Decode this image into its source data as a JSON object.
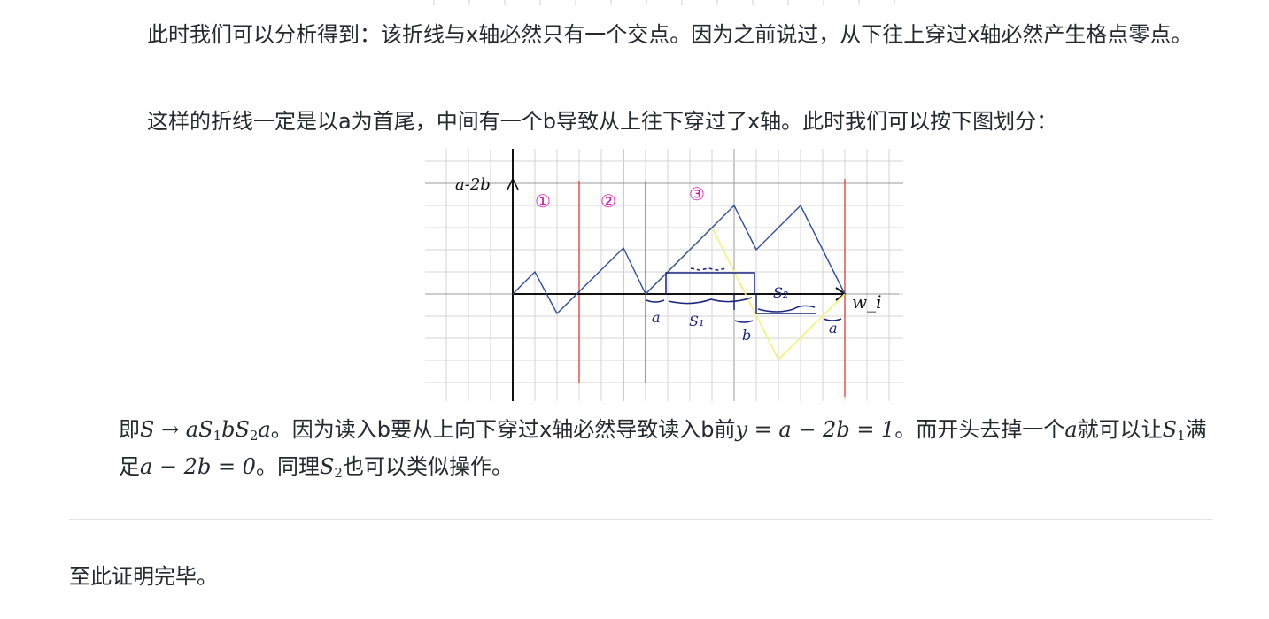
{
  "paragraph1": "此时我们可以分析得到：该折线与x轴必然只有一个交点。因为之前说过，从下往上穿过x轴必然产生格点零点。",
  "paragraph2": "这样的折线一定是以a为首尾，中间有一个b导致从上往下穿过了x轴。此时我们可以按下图划分：",
  "figure": {
    "y_label": "a-2b",
    "x_label": "w_i",
    "region_labels": [
      "①",
      "②",
      "③"
    ],
    "seg_labels": {
      "a_left": "a",
      "s1": "S₁",
      "b": "b",
      "s2": "S₂",
      "a_right": "a"
    }
  },
  "paragraph3": {
    "t1": "即",
    "m1": "S → aS",
    "m1sub1": "1",
    "m1b": "bS",
    "m1sub2": "2",
    "m1c": "a",
    "t2": "。因为读入b要从上向下穿过x轴必然导致读入b前",
    "m2": "y = a − 2b = 1",
    "t3": "。而开头去掉一个",
    "m3": "a",
    "t4": "就可以让",
    "m4": "S",
    "m4sub": "1",
    "t5": "满足",
    "m5": "a − 2b = 0",
    "t6": "。同理",
    "m6": "S",
    "m6sub": "2",
    "t7": "也可以类似操作。"
  },
  "conclusion": "至此证明完毕。",
  "colors": {
    "grid": "#c8c8c8",
    "grid_major": "#999999",
    "red": "#e8352e",
    "blue": "#2c4e9c",
    "yellow": "#f2f27a",
    "navy": "#1a237e",
    "magenta": "#d21ab4"
  }
}
